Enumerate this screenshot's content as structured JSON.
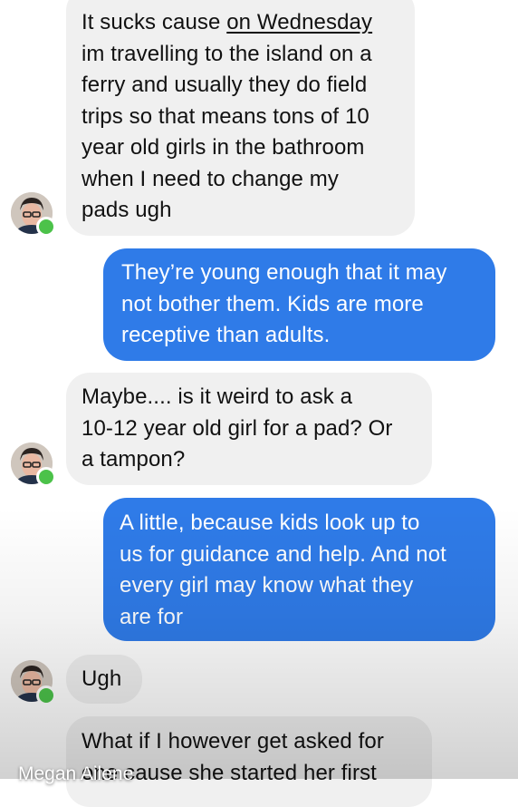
{
  "messages": [
    {
      "direction": "received",
      "lines": [
        "It sucks cause ",
        "im travelling to the island on a",
        "ferry and usually they do field",
        "trips so that means tons of 10",
        "year old girls in the bathroom",
        "when I need to change my",
        "pads ugh"
      ],
      "first_line_link": "on Wednesday"
    },
    {
      "direction": "sent",
      "lines": [
        "They’re young enough that it may",
        "not bother them. Kids are more",
        "receptive than adults."
      ]
    },
    {
      "direction": "received",
      "lines": [
        "Maybe.... is it weird to ask a",
        "10-12 year old girl for a pad? Or",
        "a tampon?"
      ]
    },
    {
      "direction": "sent",
      "lines": [
        "A little, because kids look up to",
        "us for guidance and help. And not",
        "every girl may know what they",
        "are for"
      ]
    },
    {
      "direction": "received",
      "lines": [
        "Ugh"
      ]
    },
    {
      "direction": "received",
      "lines": [
        "What if I however get asked for",
        "one cause she started her first"
      ]
    }
  ],
  "caption": "Megan Ailene",
  "colors": {
    "received_bubble": "#f0f0f0",
    "sent_bubble": "#2f7be8",
    "online_dot": "#4cc24a"
  },
  "icons": {
    "avatar": "user-avatar",
    "presence": "online-dot"
  }
}
